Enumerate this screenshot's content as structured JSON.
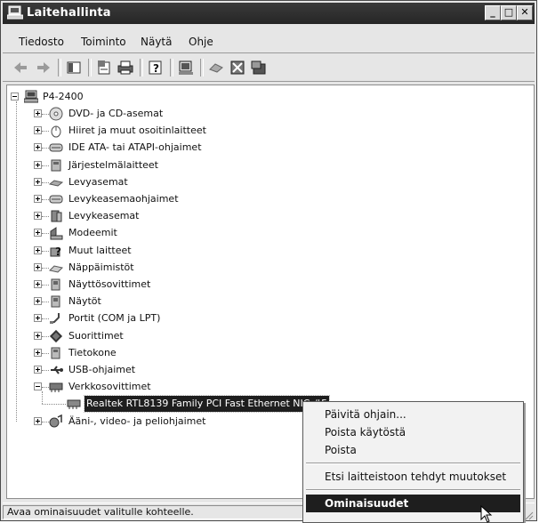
{
  "window": {
    "title": "Laitehallinta",
    "controls": {
      "minimize": "_",
      "maximize": "□",
      "close": "✕"
    }
  },
  "menu": [
    "Tiedosto",
    "Toiminto",
    "Näytä",
    "Ohje"
  ],
  "toolbar": [
    "back-arrow-icon",
    "forward-arrow-icon",
    "show-hide-console-tree-icon",
    "properties-icon",
    "print-icon",
    "help-icon",
    "scan-hardware-icon",
    "uninstall-icon",
    "disable-device-icon",
    "update-driver-icon"
  ],
  "tree": {
    "root": "P4-2400",
    "items": [
      {
        "label": "DVD- ja CD-asemat",
        "icon": "cd-drive-icon"
      },
      {
        "label": "Hiiret ja muut osoitinlaitteet",
        "icon": "mouse-icon"
      },
      {
        "label": "IDE ATA- tai ATAPI-ohjaimet",
        "icon": "ide-controller-icon"
      },
      {
        "label": "Järjestelmälaitteet",
        "icon": "system-device-icon"
      },
      {
        "label": "Levyasemat",
        "icon": "floppy-drive-icon"
      },
      {
        "label": "Levykeasemaohjaimet",
        "icon": "floppy-controller-icon"
      },
      {
        "label": "Levykeasemat",
        "icon": "disk-drive-icon"
      },
      {
        "label": "Modeemit",
        "icon": "modem-icon"
      },
      {
        "label": "Muut laitteet",
        "icon": "unknown-device-icon"
      },
      {
        "label": "Näppäimistöt",
        "icon": "keyboard-icon"
      },
      {
        "label": "Näyttösovittimet",
        "icon": "display-adapter-icon"
      },
      {
        "label": "Näytöt",
        "icon": "monitor-icon"
      },
      {
        "label": "Portit (COM ja LPT)",
        "icon": "port-icon"
      },
      {
        "label": "Suorittimet",
        "icon": "processor-icon"
      },
      {
        "label": "Tietokone",
        "icon": "computer-icon"
      },
      {
        "label": "USB-ohjaimet",
        "icon": "usb-icon"
      },
      {
        "label": "Verkkosovittimet",
        "icon": "network-adapter-icon",
        "expanded": true
      },
      {
        "label": "Realtek RTL8139 Family PCI Fast Ethernet NIC #5",
        "icon": "network-card-icon",
        "child": true,
        "selected": true
      },
      {
        "label": "Ääni-, video- ja peliohjaimet",
        "icon": "sound-icon"
      }
    ]
  },
  "context_menu": [
    {
      "label": "Päivitä ohjain..."
    },
    {
      "label": "Poista käytöstä"
    },
    {
      "label": "Poista"
    },
    {
      "separator": true
    },
    {
      "label": "Etsi laitteistoon tehdyt muutokset"
    },
    {
      "separator": true
    },
    {
      "label": "Ominaisuudet",
      "highlighted": true
    }
  ],
  "status": "Avaa ominaisuudet valitulle kohteelle."
}
